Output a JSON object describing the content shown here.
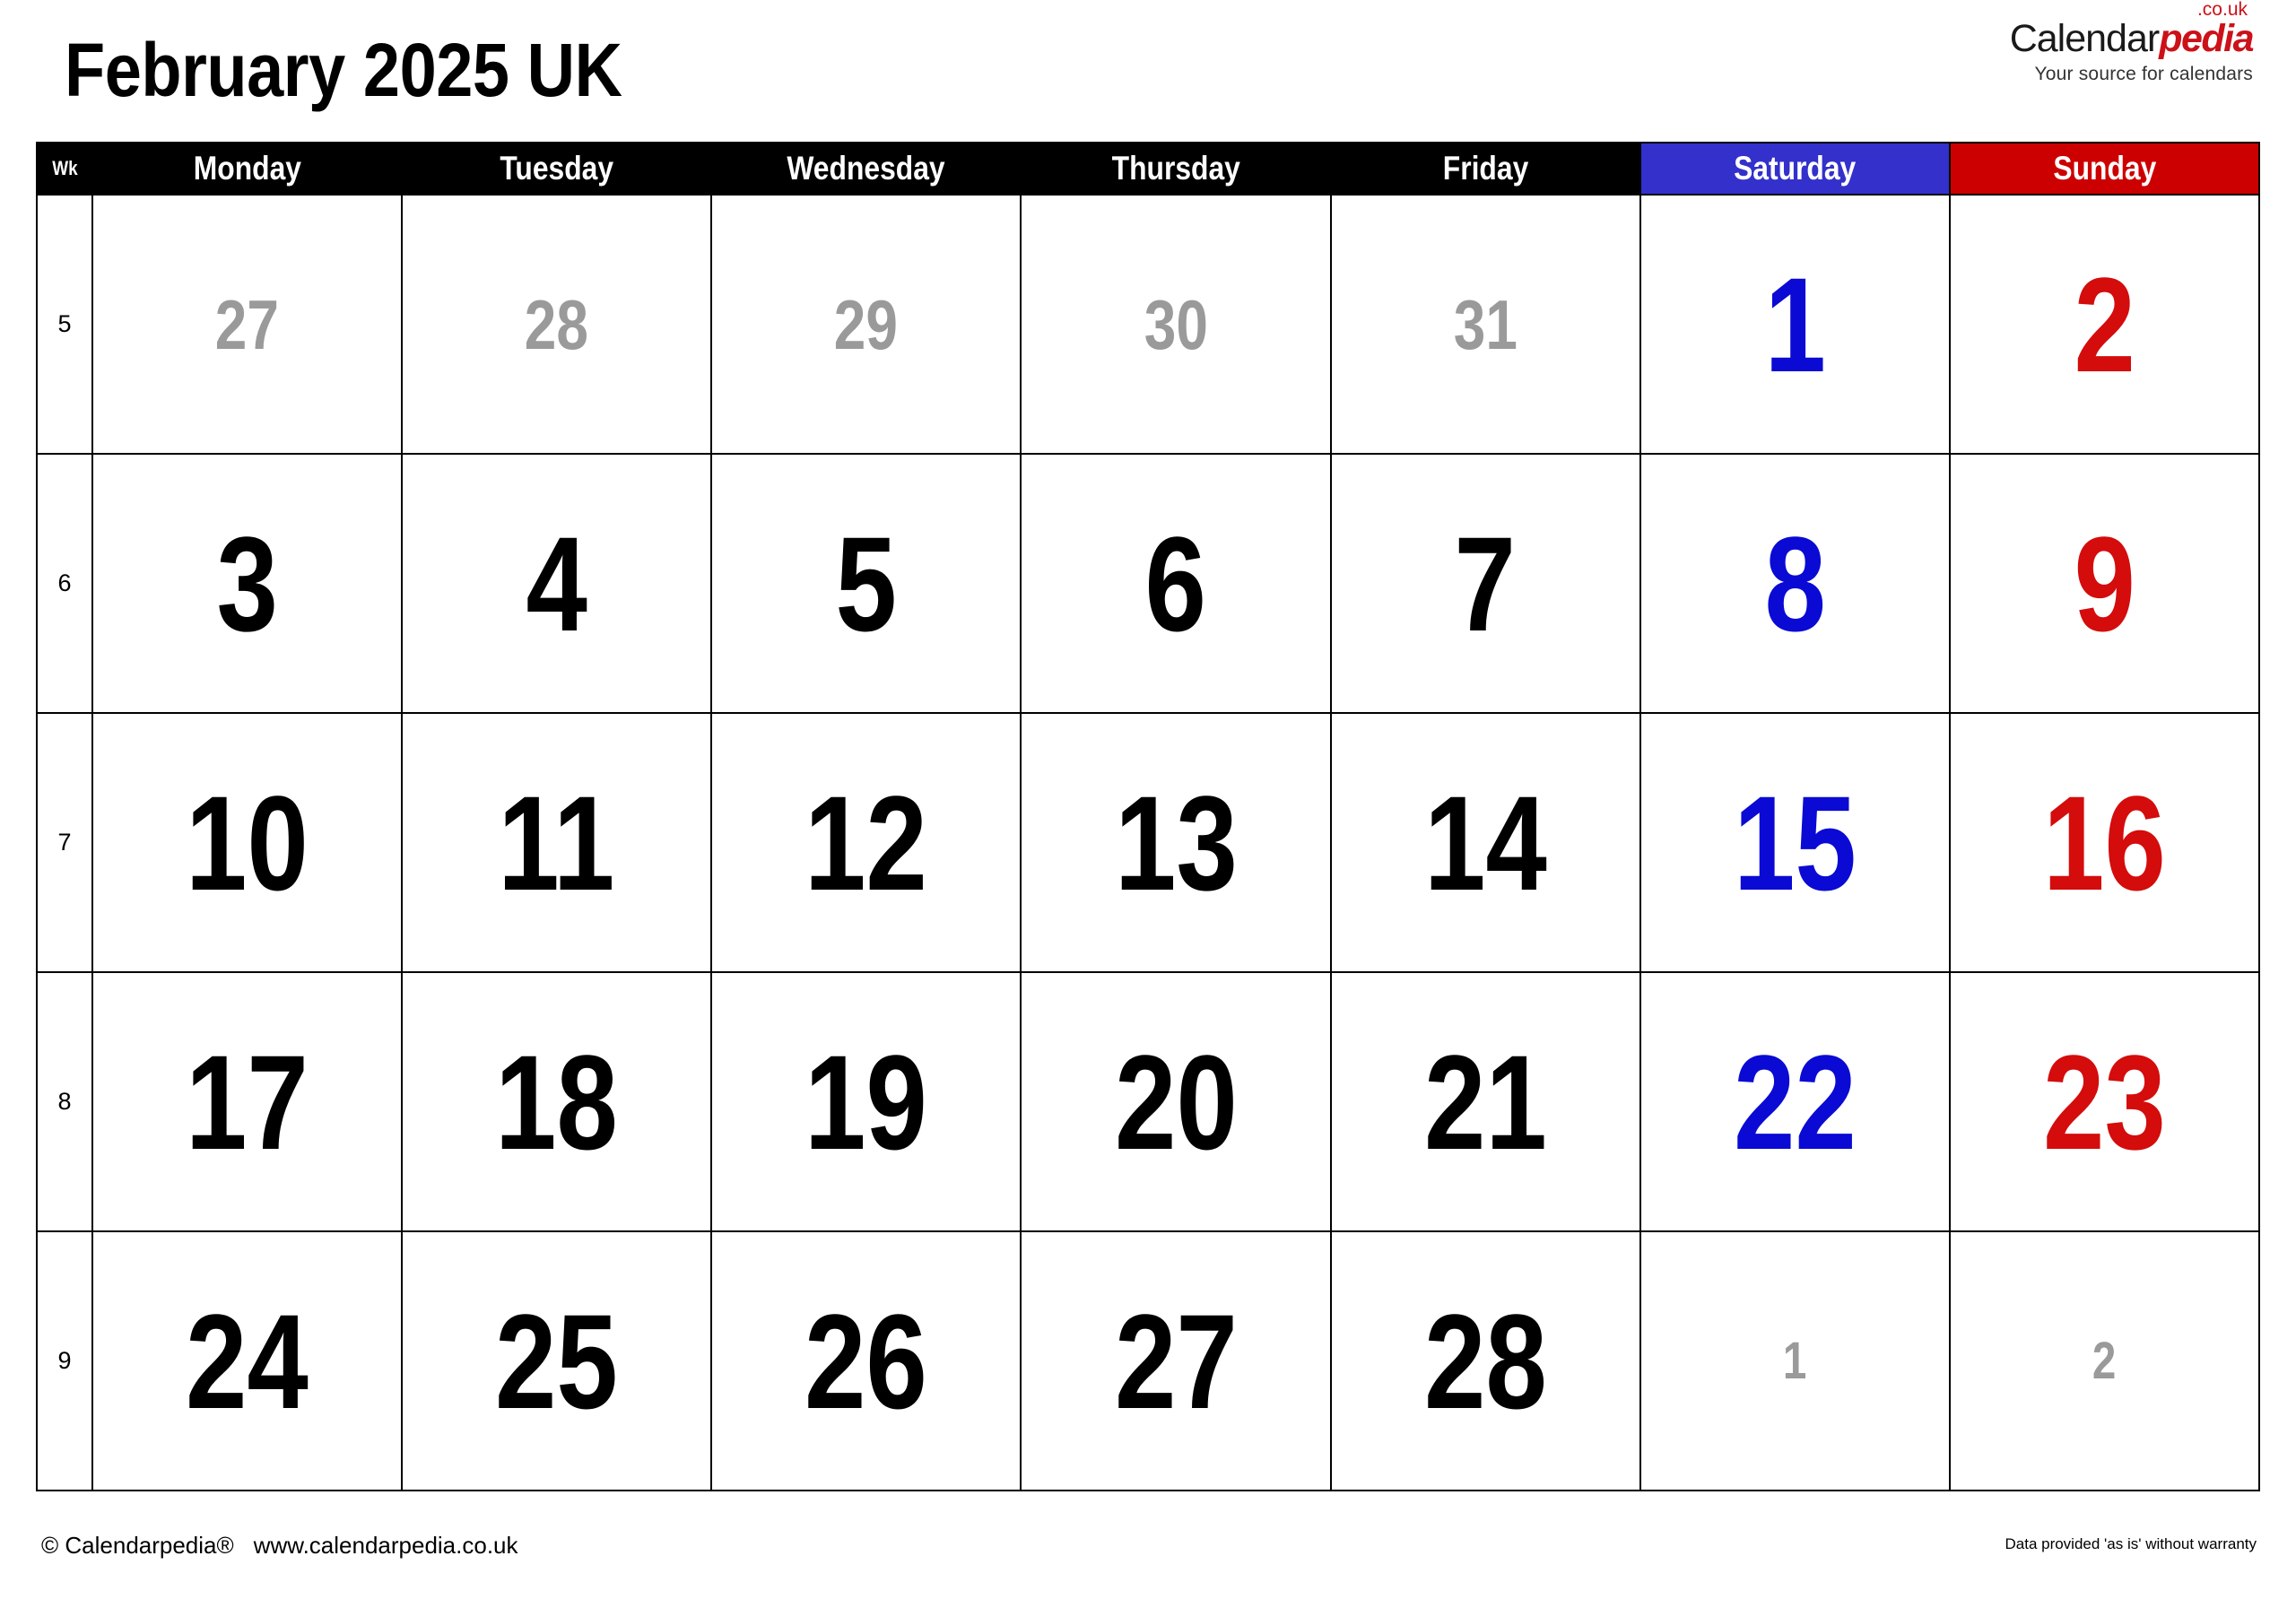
{
  "title": "February 2025 UK",
  "brand": {
    "name_black": "Calendar",
    "name_red": "pedia",
    "tld": ".co.uk",
    "tagline": "Your source for calendars"
  },
  "colors": {
    "saturday": "#3330cc",
    "sunday": "#cc0000",
    "saturday_number": "#0a0ad4",
    "sunday_number": "#d40c0c",
    "out_of_month": "#9a9a9a",
    "header_bg": "#000000"
  },
  "header": {
    "week_label": "Wk",
    "days": [
      "Monday",
      "Tuesday",
      "Wednesday",
      "Thursday",
      "Friday",
      "Saturday",
      "Sunday"
    ]
  },
  "weeks": [
    {
      "wk": "5",
      "days": [
        {
          "n": "27",
          "type": "out"
        },
        {
          "n": "28",
          "type": "out"
        },
        {
          "n": "29",
          "type": "out"
        },
        {
          "n": "30",
          "type": "out"
        },
        {
          "n": "31",
          "type": "out"
        },
        {
          "n": "1",
          "type": "sat"
        },
        {
          "n": "2",
          "type": "sun"
        }
      ]
    },
    {
      "wk": "6",
      "days": [
        {
          "n": "3",
          "type": "day"
        },
        {
          "n": "4",
          "type": "day"
        },
        {
          "n": "5",
          "type": "day"
        },
        {
          "n": "6",
          "type": "day"
        },
        {
          "n": "7",
          "type": "day"
        },
        {
          "n": "8",
          "type": "sat"
        },
        {
          "n": "9",
          "type": "sun"
        }
      ]
    },
    {
      "wk": "7",
      "days": [
        {
          "n": "10",
          "type": "day"
        },
        {
          "n": "11",
          "type": "day"
        },
        {
          "n": "12",
          "type": "day"
        },
        {
          "n": "13",
          "type": "day"
        },
        {
          "n": "14",
          "type": "day"
        },
        {
          "n": "15",
          "type": "sat"
        },
        {
          "n": "16",
          "type": "sun"
        }
      ]
    },
    {
      "wk": "8",
      "days": [
        {
          "n": "17",
          "type": "day"
        },
        {
          "n": "18",
          "type": "day"
        },
        {
          "n": "19",
          "type": "day"
        },
        {
          "n": "20",
          "type": "day"
        },
        {
          "n": "21",
          "type": "day"
        },
        {
          "n": "22",
          "type": "sat"
        },
        {
          "n": "23",
          "type": "sun"
        }
      ]
    },
    {
      "wk": "9",
      "days": [
        {
          "n": "24",
          "type": "day"
        },
        {
          "n": "25",
          "type": "day"
        },
        {
          "n": "26",
          "type": "day"
        },
        {
          "n": "27",
          "type": "day"
        },
        {
          "n": "28",
          "type": "day"
        },
        {
          "n": "1",
          "type": "out-small"
        },
        {
          "n": "2",
          "type": "out-small"
        }
      ]
    }
  ],
  "footer": {
    "copyright": "© Calendarpedia®",
    "website": "www.calendarpedia.co.uk",
    "disclaimer": "Data provided 'as is' without warranty"
  }
}
